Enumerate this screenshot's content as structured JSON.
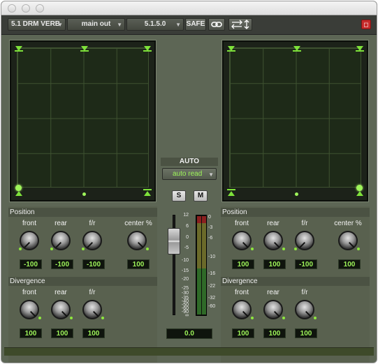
{
  "toolbar": {
    "track_name": "5.1 DRM VERB",
    "output": "main out",
    "format": "5.1.5.0",
    "safe_label": "SAFE",
    "link_icon": "link-icon",
    "flip_icon": "swap-arrows-icon",
    "close_icon": "close-icon"
  },
  "auto": {
    "title": "AUTO",
    "mode": "auto read",
    "solo_label": "S",
    "mute_label": "M"
  },
  "fader": {
    "value": "0.0",
    "scale": [
      "12",
      "6",
      "0",
      "-5",
      "-10",
      "-15",
      "-20",
      "-25",
      "-30",
      "-35",
      "-40",
      "-50",
      "-60",
      "-90",
      "∞"
    ]
  },
  "meter": {
    "scale": [
      "0",
      "-3",
      "-6",
      "-10",
      "-16",
      "-22",
      "-32",
      "-60"
    ]
  },
  "left": {
    "position": {
      "title": "Position",
      "front_label": "front",
      "front_value": "-100",
      "rear_label": "rear",
      "rear_value": "-100",
      "fr_label": "f/r",
      "fr_value": "-100",
      "center_label": "center %",
      "center_value": "100"
    },
    "divergence": {
      "title": "Divergence",
      "front_label": "front",
      "front_value": "100",
      "rear_label": "rear",
      "rear_value": "100",
      "fr_label": "f/r",
      "fr_value": "100"
    }
  },
  "right": {
    "position": {
      "title": "Position",
      "front_label": "front",
      "front_value": "100",
      "rear_label": "rear",
      "rear_value": "100",
      "fr_label": "f/r",
      "fr_value": "-100",
      "center_label": "center %",
      "center_value": "100"
    },
    "divergence": {
      "title": "Divergence",
      "front_label": "front",
      "front_value": "100",
      "rear_label": "rear",
      "rear_value": "100",
      "fr_label": "f/r",
      "fr_value": "100"
    }
  },
  "colors": {
    "accent_green": "#9ef55a",
    "close_red": "#c52a2a"
  }
}
